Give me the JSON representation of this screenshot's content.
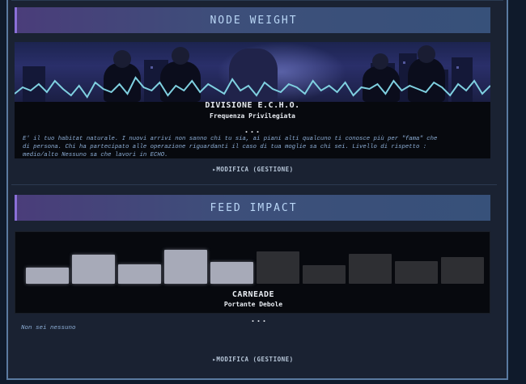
{
  "node_weight": {
    "header": "NODE WEIGHT",
    "title": "DIVISIONE E.C.H.O.",
    "subtitle": "Frequenza Privilegiata",
    "ellipsis": "...",
    "description_lines": [
      "E' il tuo habitat naturale. I nuovi arrivi non sanno chi tu sia, ai piani alti qualcuno ti conosce più per \"fama\" che",
      "di persona. Chi ha partecipato alle operazione riguardanti il caso di tua moglie sa chi sei. Livello di rispetto :",
      "medio/alto Nessuno sa che lavori in ECHO."
    ],
    "action_label": "▸MODIFICA (GESTIONE)"
  },
  "feed_impact": {
    "header": "FEED IMPACT",
    "title": "CARNEADE",
    "subtitle": "Portante Debole",
    "ellipsis": "...",
    "description": "Non sei nessuno",
    "action_label": "▸MODIFICA (GESTIONE)",
    "level_bars": [
      {
        "level": 0.47,
        "lit": true
      },
      {
        "level": 0.85,
        "lit": true
      },
      {
        "level": 0.58,
        "lit": true
      },
      {
        "level": 1.0,
        "lit": true
      },
      {
        "level": 0.65,
        "lit": true
      },
      {
        "level": 0.95,
        "lit": false
      },
      {
        "level": 0.55,
        "lit": false
      },
      {
        "level": 0.88,
        "lit": false
      },
      {
        "level": 0.67,
        "lit": false
      },
      {
        "level": 0.78,
        "lit": false
      }
    ]
  },
  "colors": {
    "accent_purple": "#8a6fd8",
    "header_text": "#b9d6f5",
    "wave": "#7fd0e0",
    "description_text": "#8fb0d8"
  }
}
